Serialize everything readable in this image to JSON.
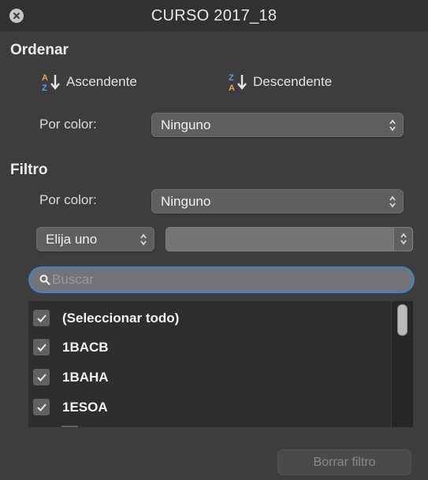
{
  "window": {
    "title": "CURSO 2017_18"
  },
  "sort": {
    "header": "Ordenar",
    "ascending_label": "Ascendente",
    "descending_label": "Descendente",
    "by_color_label": "Por color:",
    "by_color_value": "Ninguno"
  },
  "filter": {
    "header": "Filtro",
    "by_color_label": "Por color:",
    "by_color_value": "Ninguno",
    "condition_value": "Elija uno",
    "criteria_value": "",
    "search_placeholder": "Buscar",
    "items": [
      {
        "label": "(Seleccionar todo)",
        "checked": true
      },
      {
        "label": "1BACB",
        "checked": true
      },
      {
        "label": "1BAHA",
        "checked": true
      },
      {
        "label": "1ESOA",
        "checked": true
      }
    ]
  },
  "footer": {
    "clear_filter_label": "Borrar filtro"
  },
  "colors": {
    "background": "#3d3d3f",
    "focus_ring": "#4f7fb0",
    "list_background": "#2e2e30"
  }
}
